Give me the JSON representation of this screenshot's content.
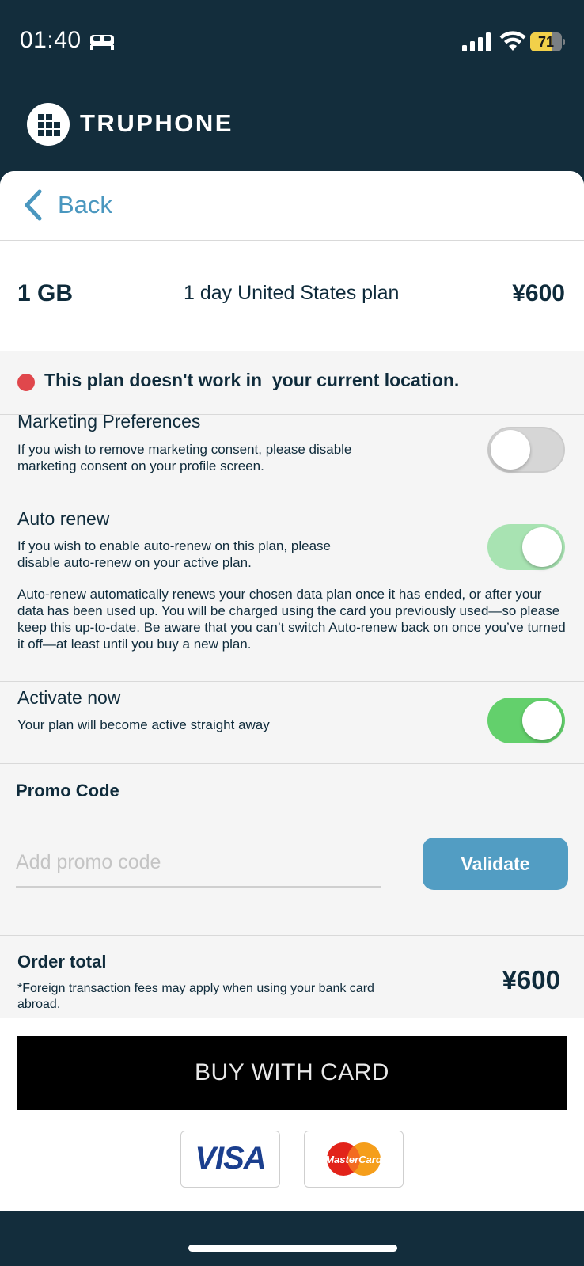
{
  "status_bar": {
    "time": "01:40",
    "battery": "71",
    "battery_level": 0.71,
    "icons": [
      "bed-icon",
      "signal-icon",
      "wifi-icon",
      "battery-icon"
    ]
  },
  "brand": {
    "name": "TRUPHONE"
  },
  "nav": {
    "back_label": "Back"
  },
  "plan": {
    "size": "1 GB",
    "name": "1 day United States plan",
    "price": "¥600"
  },
  "warning": {
    "text": "This plan doesn't work in  your current location."
  },
  "settings": {
    "marketing": {
      "title": "Marketing Preferences",
      "desc": "If you wish to remove marketing consent, please disable marketing consent on your profile screen.",
      "enabled": false
    },
    "auto_renew": {
      "title": "Auto renew",
      "desc": "If you wish to enable auto-renew on this plan, please disable auto-renew on your active plan.",
      "note": "Auto-renew automatically renews your chosen data plan once it has ended, or after your data has been used up. You will be charged using the card you previously used—so please keep this up-to-date. Be aware that you can’t switch Auto-renew back on once you’ve turned it off—at least until you buy a new plan.",
      "enabled": true
    },
    "activate_now": {
      "title": "Activate now",
      "desc": "Your plan will become active straight away",
      "enabled": true
    }
  },
  "promo": {
    "title": "Promo Code",
    "placeholder": "Add promo code",
    "value": "",
    "validate_label": "Validate"
  },
  "order": {
    "title": "Order total",
    "note": "*Foreign transaction fees may apply when using your bank card abroad.",
    "total": "¥600"
  },
  "payment": {
    "buy_label": "BUY WITH CARD",
    "methods": [
      "VISA",
      "MasterCard"
    ]
  },
  "colors": {
    "header_bg": "#132d3c",
    "accent": "#529dc3",
    "toggle_on": "#63d06c",
    "warning": "#e0474c"
  }
}
